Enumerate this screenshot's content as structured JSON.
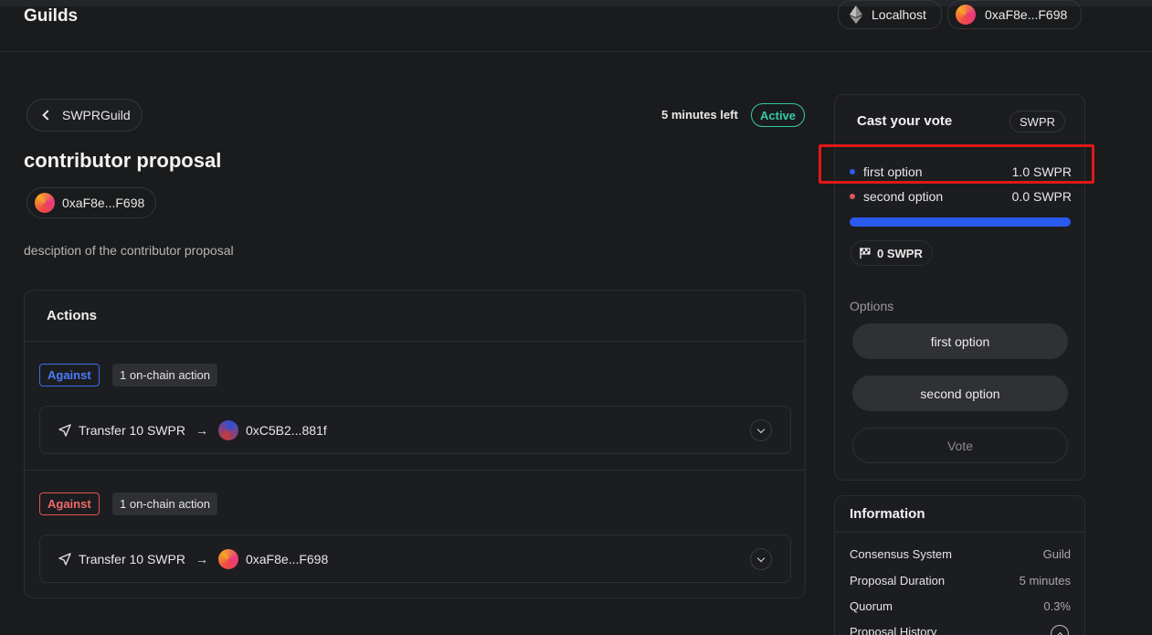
{
  "header": {
    "brand": "Guilds",
    "network": "Localhost",
    "wallet": "0xaF8e...F698"
  },
  "proposal": {
    "back_label": "SWPRGuild",
    "time_left": "5 minutes left",
    "status": "Active",
    "title": "contributor proposal",
    "author": "0xaF8e...F698",
    "description": "desciption of the contributor proposal"
  },
  "actions": {
    "heading": "Actions",
    "groups": [
      {
        "tag": "Against",
        "count": "1 on-chain action",
        "action_label": "Transfer 10 SWPR",
        "recipient": "0xC5B2...881f"
      },
      {
        "tag": "Against",
        "count": "1 on-chain action",
        "action_label": "Transfer 10 SWPR",
        "recipient": "0xaF8e...F698"
      }
    ]
  },
  "vote": {
    "title": "Cast your vote",
    "token": "SWPR",
    "results": [
      {
        "label": "first option",
        "value": "1.0 SWPR",
        "color": "#2f5bf0"
      },
      {
        "label": "second option",
        "value": "0.0 SWPR",
        "color": "#e25555"
      }
    ],
    "progress_fraction": 1.0,
    "quorum": "0 SWPR",
    "options_label": "Options",
    "options": [
      "first option",
      "second option"
    ],
    "vote_label": "Vote"
  },
  "information": {
    "heading": "Information",
    "rows": [
      {
        "key": "Consensus System",
        "value": "Guild"
      },
      {
        "key": "Proposal Duration",
        "value": "5 minutes"
      },
      {
        "key": "Quorum",
        "value": "0.3%"
      },
      {
        "key": "Proposal History",
        "value": ""
      }
    ]
  },
  "colors": {
    "accent_blue": "#2a5af0",
    "active_green": "#36c9a5",
    "against_red": "#e05353",
    "highlight_red": "#e01818"
  }
}
